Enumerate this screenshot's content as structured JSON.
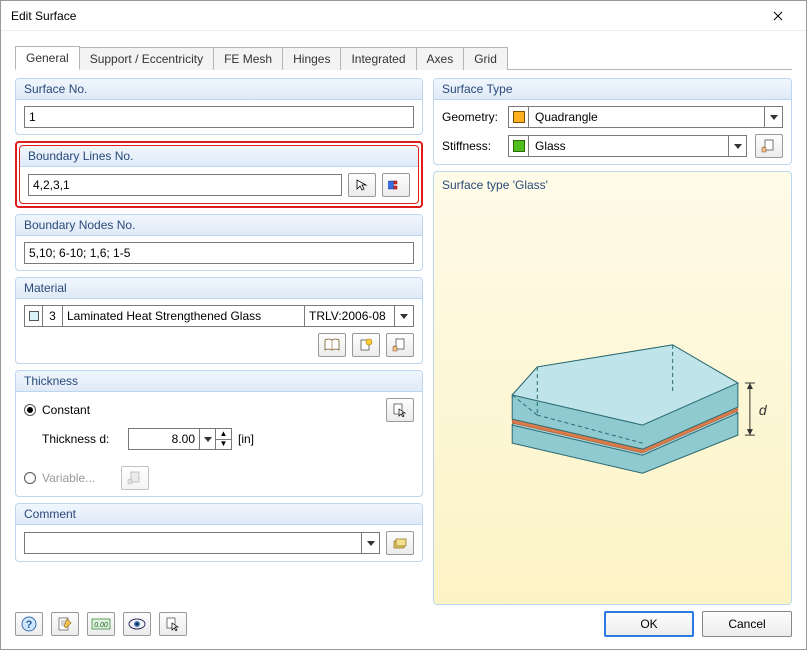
{
  "window": {
    "title": "Edit Surface"
  },
  "tabs": [
    "General",
    "Support / Eccentricity",
    "FE Mesh",
    "Hinges",
    "Integrated",
    "Axes",
    "Grid"
  ],
  "active_tab": 0,
  "surface_no": {
    "label": "Surface No.",
    "value": "1"
  },
  "boundary_lines": {
    "label": "Boundary Lines No.",
    "value": "4,2,3,1"
  },
  "boundary_nodes": {
    "label": "Boundary Nodes No.",
    "value": "5,10; 6-10; 1,6; 1-5"
  },
  "material": {
    "label": "Material",
    "index": "3",
    "name": "Laminated Heat Strengthened Glass",
    "code": "TRLV:2006-08"
  },
  "thickness": {
    "label": "Thickness",
    "mode_constant": "Constant",
    "mode_variable": "Variable...",
    "d_label": "Thickness d:",
    "d_value": "8.00",
    "d_unit": "[in]"
  },
  "comment": {
    "label": "Comment",
    "value": ""
  },
  "surface_type": {
    "label": "Surface Type",
    "geometry_label": "Geometry:",
    "geometry_value": "Quadrangle",
    "stiffness_label": "Stiffness:",
    "stiffness_value": "Glass"
  },
  "preview_label": "Surface type 'Glass'",
  "preview_annotation": "d",
  "buttons": {
    "ok": "OK",
    "cancel": "Cancel"
  }
}
